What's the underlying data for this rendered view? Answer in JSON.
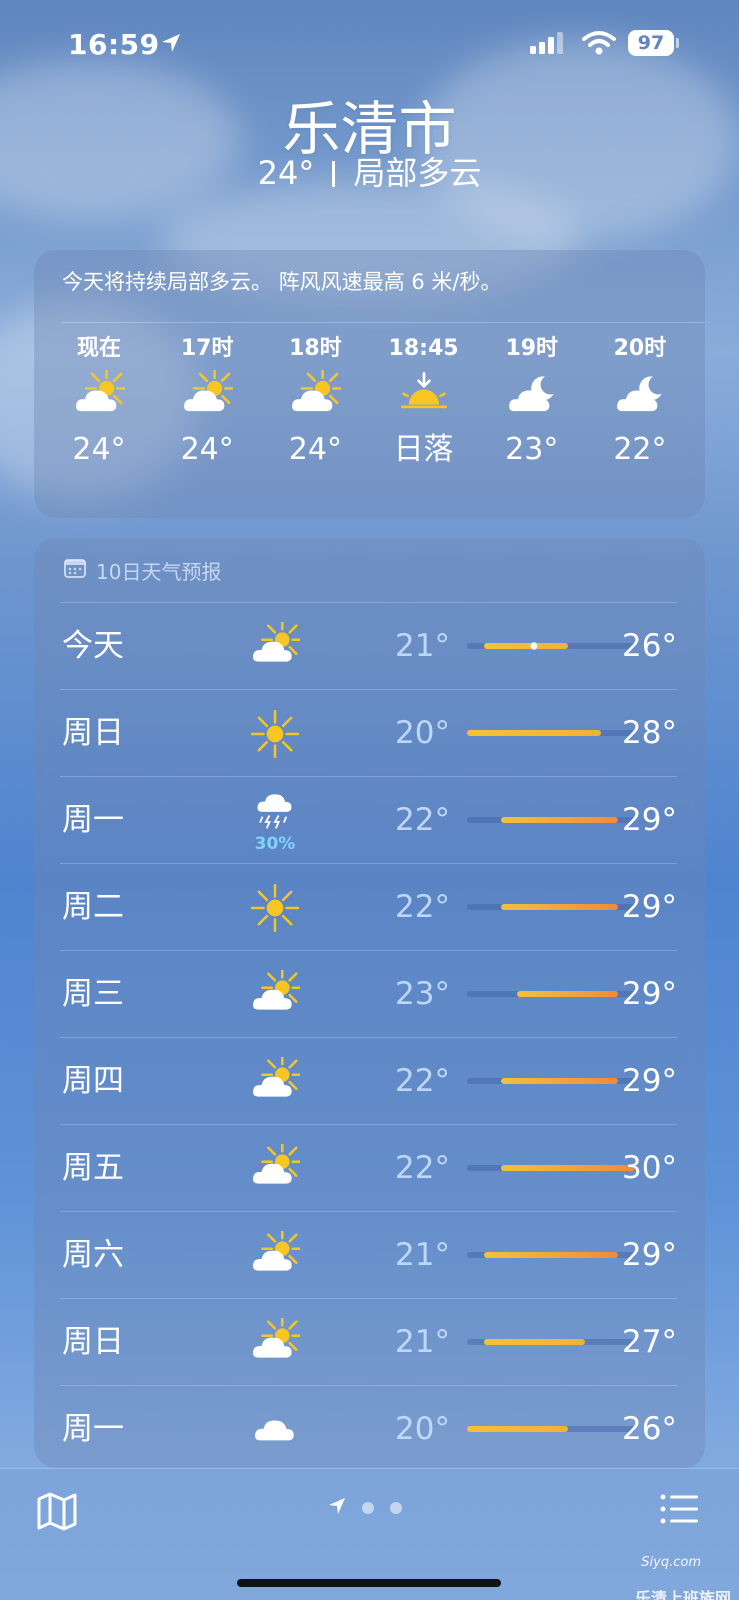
{
  "status": {
    "time": "16:59",
    "battery": "97"
  },
  "header": {
    "city": "乐清市",
    "temp": "24°",
    "condition": "局部多云"
  },
  "hourly": {
    "summary": "今天将持续局部多云。 阵风风速最高 6 米/秒。",
    "items": [
      {
        "label": "现在",
        "icon": "partly-cloudy-day-icon",
        "value": "24°"
      },
      {
        "label": "17时",
        "icon": "partly-cloudy-day-icon",
        "value": "24°"
      },
      {
        "label": "18时",
        "icon": "partly-cloudy-day-icon",
        "value": "24°"
      },
      {
        "label": "18:45",
        "icon": "sunset-icon",
        "value": "日落"
      },
      {
        "label": "19时",
        "icon": "partly-cloudy-night-icon",
        "value": "23°"
      },
      {
        "label": "20时",
        "icon": "partly-cloudy-night-icon",
        "value": "22°"
      }
    ]
  },
  "daily": {
    "title": "10日天气预报",
    "scale": {
      "min": 20,
      "max": 30
    },
    "days": [
      {
        "day": "今天",
        "icon": "partly-cloudy-day-icon",
        "lo": "21°",
        "hi": "26°",
        "low": 21,
        "high": 26,
        "current": 24
      },
      {
        "day": "周日",
        "icon": "sun-icon",
        "lo": "20°",
        "hi": "28°",
        "low": 20,
        "high": 28
      },
      {
        "day": "周一",
        "icon": "thunderstorm-icon",
        "pop": "30%",
        "lo": "22°",
        "hi": "29°",
        "low": 22,
        "high": 29
      },
      {
        "day": "周二",
        "icon": "sun-icon",
        "lo": "22°",
        "hi": "29°",
        "low": 22,
        "high": 29
      },
      {
        "day": "周三",
        "icon": "partly-cloudy-day-icon",
        "lo": "23°",
        "hi": "29°",
        "low": 23,
        "high": 29
      },
      {
        "day": "周四",
        "icon": "partly-cloudy-day-icon",
        "lo": "22°",
        "hi": "29°",
        "low": 22,
        "high": 29
      },
      {
        "day": "周五",
        "icon": "partly-cloudy-day-icon",
        "lo": "22°",
        "hi": "30°",
        "low": 22,
        "high": 30
      },
      {
        "day": "周六",
        "icon": "partly-cloudy-day-icon",
        "lo": "21°",
        "hi": "29°",
        "low": 21,
        "high": 29
      },
      {
        "day": "周日",
        "icon": "partly-cloudy-day-icon",
        "lo": "21°",
        "hi": "27°",
        "low": 21,
        "high": 27
      },
      {
        "day": "周一",
        "icon": "cloud-icon",
        "lo": "20°",
        "hi": "26°",
        "low": 20,
        "high": 26
      }
    ]
  },
  "toolbar": {
    "map_icon": "map-icon",
    "list_icon": "list-icon"
  },
  "watermark": {
    "logo": "Siyq.com",
    "text": "乐清上班族网"
  },
  "colors": {
    "bar_warm": "#f2c23a",
    "bar_hot": "#f08a3c",
    "pop": "#7fd3ff"
  }
}
